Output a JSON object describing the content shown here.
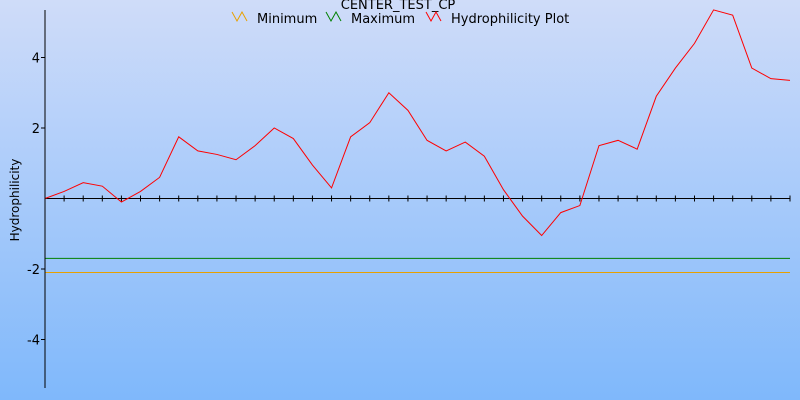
{
  "chart_data": {
    "type": "line",
    "title": "CENTER_TEST_CP",
    "ylabel": "Hydrophilicity",
    "xlabel": "",
    "ylim": [
      -5.5,
      5.5
    ],
    "yticks": [
      {
        "value": 4,
        "label": "4"
      },
      {
        "value": 2,
        "label": "2"
      },
      {
        "value": -2,
        "label": "-2"
      },
      {
        "value": -4,
        "label": "-4"
      }
    ],
    "x_count": 40,
    "legend_position": "top",
    "grid": false,
    "series": [
      {
        "name": "Minimum",
        "color": "#e8a000",
        "values": [
          -2.1,
          -2.1,
          -2.1,
          -2.1,
          -2.1,
          -2.1,
          -2.1,
          -2.1,
          -2.1,
          -2.1,
          -2.1,
          -2.1,
          -2.1,
          -2.1,
          -2.1,
          -2.1,
          -2.1,
          -2.1,
          -2.1,
          -2.1,
          -2.1,
          -2.1,
          -2.1,
          -2.1,
          -2.1,
          -2.1,
          -2.1,
          -2.1,
          -2.1,
          -2.1,
          -2.1,
          -2.1,
          -2.1,
          -2.1,
          -2.1,
          -2.1,
          -2.1,
          -2.1,
          -2.1,
          -2.1
        ]
      },
      {
        "name": "Maximum",
        "color": "#008000",
        "values": [
          -1.7,
          -1.7,
          -1.7,
          -1.7,
          -1.7,
          -1.7,
          -1.7,
          -1.7,
          -1.7,
          -1.7,
          -1.7,
          -1.7,
          -1.7,
          -1.7,
          -1.7,
          -1.7,
          -1.7,
          -1.7,
          -1.7,
          -1.7,
          -1.7,
          -1.7,
          -1.7,
          -1.7,
          -1.7,
          -1.7,
          -1.7,
          -1.7,
          -1.7,
          -1.7,
          -1.7,
          -1.7,
          -1.7,
          -1.7,
          -1.7,
          -1.7,
          -1.7,
          -1.7,
          -1.7,
          -1.7
        ]
      },
      {
        "name": "Hydrophilicity Plot",
        "color": "#ff0000",
        "values": [
          0.0,
          0.2,
          0.45,
          0.35,
          -0.1,
          0.2,
          0.6,
          1.75,
          1.35,
          1.25,
          1.1,
          1.5,
          2.0,
          1.7,
          0.95,
          0.3,
          1.75,
          2.15,
          3.0,
          2.5,
          1.65,
          1.35,
          1.6,
          1.2,
          0.25,
          -0.5,
          -1.05,
          -0.4,
          -0.2,
          1.5,
          1.65,
          1.4,
          2.9,
          3.7,
          4.4,
          5.35,
          5.2,
          3.7,
          3.4,
          3.35
        ]
      }
    ]
  }
}
